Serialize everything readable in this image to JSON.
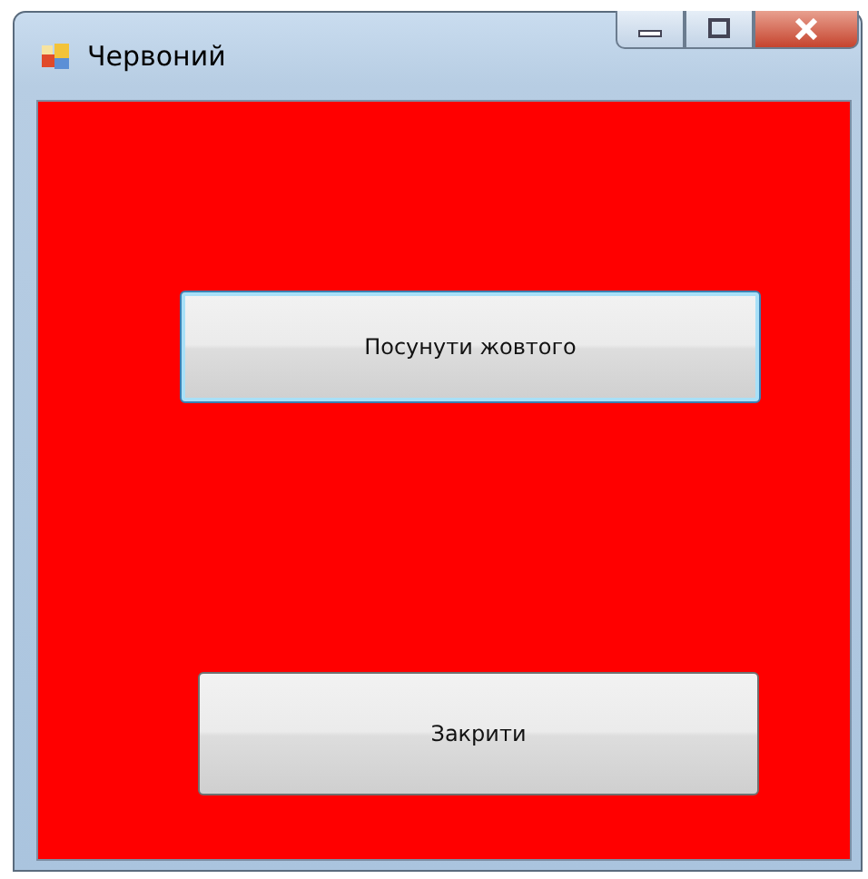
{
  "window": {
    "title": "Червоний"
  },
  "buttons": [
    {
      "label": "Посунути жовтого",
      "focused": true
    },
    {
      "label": "Закрити",
      "focused": false
    }
  ]
}
